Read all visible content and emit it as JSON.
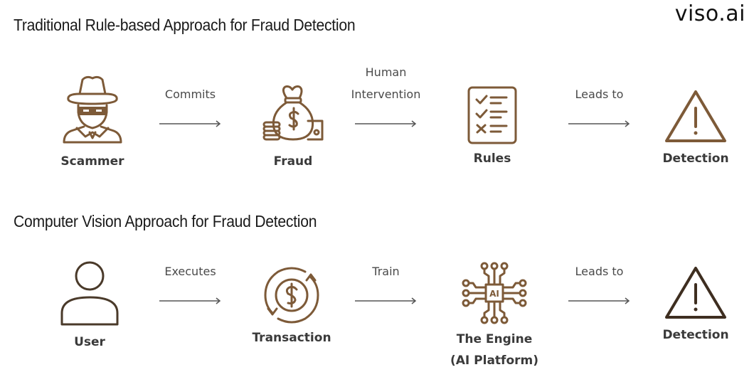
{
  "brand": {
    "logo_text": "viso.ai"
  },
  "colors": {
    "icon_brown": "#7d5a38",
    "text_dark": "#3a3a3a",
    "arrow_gray": "#555555"
  },
  "traditional": {
    "title": "Traditional Rule-based Approach for Fraud Detection",
    "nodes": [
      {
        "label": "Scammer",
        "icon": "scammer-icon"
      },
      {
        "label": "Fraud",
        "icon": "money-bag-icon"
      },
      {
        "label": "Rules",
        "icon": "checklist-icon"
      },
      {
        "label": "Detection",
        "icon": "warning-triangle-icon"
      }
    ],
    "edges": [
      {
        "line1": "",
        "line2": "Commits"
      },
      {
        "line1": "Human",
        "line2": "Intervention"
      },
      {
        "line1": "",
        "line2": "Leads to"
      }
    ]
  },
  "computer_vision": {
    "title": "Computer Vision Approach for Fraud Detection",
    "nodes": [
      {
        "label": "User",
        "label2": "",
        "icon": "user-icon"
      },
      {
        "label": "Transaction",
        "label2": "",
        "icon": "transaction-dollar-cycle-icon"
      },
      {
        "label": "The Engine",
        "label2": "(AI Platform)",
        "icon": "ai-chip-icon"
      },
      {
        "label": "Detection",
        "label2": "",
        "icon": "warning-triangle-icon"
      }
    ],
    "edges": [
      {
        "label": "Executes"
      },
      {
        "label": "Train"
      },
      {
        "label": "Leads to"
      }
    ]
  }
}
